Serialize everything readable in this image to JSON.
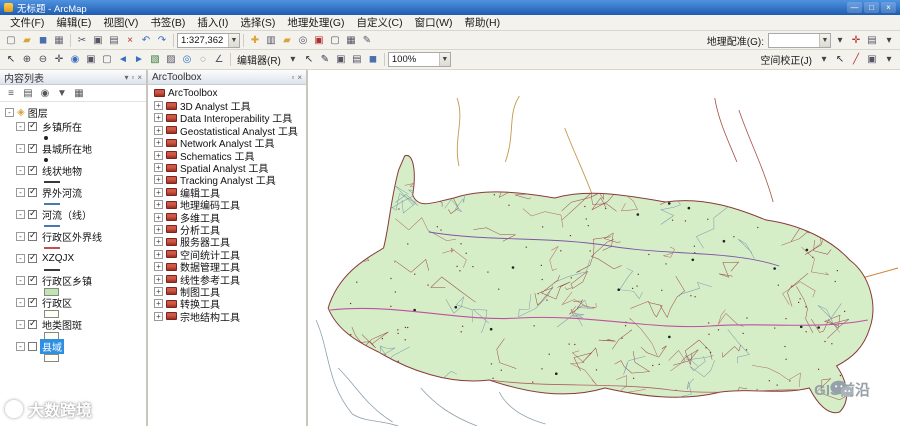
{
  "window": {
    "title": "无标题 - ArcMap"
  },
  "titlebar_controls": {
    "minimize": "—",
    "maximize": "□",
    "close": "×"
  },
  "menus": [
    "文件(F)",
    "编辑(E)",
    "视图(V)",
    "书签(B)",
    "插入(I)",
    "选择(S)",
    "地理处理(G)",
    "自定义(C)",
    "窗口(W)",
    "帮助(H)"
  ],
  "toolbars": {
    "scale_value": "1:327,362",
    "zoom_value": "100%",
    "georeferencing_label": "地理配准(G):",
    "editor_label": "编辑器(R)",
    "spatial_adjustment_label": "空间校正(J)",
    "row1_file_icons": [
      [
        "new-document",
        "▢",
        "#667"
      ],
      [
        "open-folder",
        "▰",
        "#d9a33a"
      ],
      [
        "save",
        "◼",
        "#4a6fae"
      ],
      [
        "print",
        "▦",
        "#667"
      ]
    ],
    "row1_edit_icons": [
      [
        "cut",
        "✂",
        "#556"
      ],
      [
        "copy",
        "▣",
        "#556"
      ],
      [
        "paste",
        "▤",
        "#556"
      ],
      [
        "delete",
        "×",
        "#b03030"
      ],
      [
        "undo",
        "↶",
        "#3a6fc0"
      ],
      [
        "redo",
        "↷",
        "#3a6fc0"
      ]
    ],
    "row1_map_icons": [
      [
        "add-data",
        "✚",
        "#d9a33a"
      ],
      [
        "table-of-contents",
        "▥",
        "#556"
      ],
      [
        "catalog-window",
        "▰",
        "#d9a33a"
      ],
      [
        "search-window",
        "◎",
        "#556"
      ],
      [
        "arctoolbox-window",
        "▣",
        "#b03030"
      ],
      [
        "python-window",
        "▢",
        "#556"
      ],
      [
        "model-builder",
        "▦",
        "#556"
      ],
      [
        "editor-toolbar-toggle",
        "✎",
        "#556"
      ]
    ],
    "row1_georef_icons": [
      [
        "georef-dropdown",
        "▾",
        "#444"
      ],
      [
        "add-control-points",
        "✛",
        "#b03030"
      ],
      [
        "view-link-table",
        "▤",
        "#556"
      ]
    ],
    "row2_nav_icons": [
      [
        "select-elements",
        "↖",
        "#334"
      ],
      [
        "zoom-in-tool",
        "⊕",
        "#445"
      ],
      [
        "zoom-out-tool",
        "⊖",
        "#445"
      ],
      [
        "pan-tool",
        "✛",
        "#445"
      ],
      [
        "full-extent",
        "◉",
        "#3a6fc0"
      ],
      [
        "fixed-zoom-in",
        "▣",
        "#556"
      ],
      [
        "fixed-zoom-out",
        "▢",
        "#556"
      ],
      [
        "previous-extent",
        "◄",
        "#3a6fc0"
      ],
      [
        "next-extent",
        "►",
        "#3a6fc0"
      ],
      [
        "select-by-rectangle",
        "▧",
        "#3a7a3a"
      ],
      [
        "clear-selection",
        "▨",
        "#556"
      ],
      [
        "identify",
        "◎",
        "#2a6fc0"
      ],
      [
        "find",
        "◌",
        "#556"
      ],
      [
        "measure",
        "∠",
        "#556"
      ]
    ],
    "row2_editor_icons": [
      [
        "editor-dropdown",
        "▾",
        "#444"
      ],
      [
        "edit-pointer",
        "↖",
        "#334"
      ],
      [
        "sketch-tool",
        "✎",
        "#334"
      ],
      [
        "create-features",
        "▣",
        "#556"
      ],
      [
        "attributes",
        "▤",
        "#556"
      ],
      [
        "save-edits",
        "◼",
        "#4a6fae"
      ]
    ],
    "row2_spatial_icons": [
      [
        "spatial-dropdown",
        "▾",
        "#444"
      ],
      [
        "adjust-pointer",
        "↖",
        "#334"
      ],
      [
        "new-displacement-link",
        "╱",
        "#b03030"
      ],
      [
        "run-adjust",
        "▣",
        "#556"
      ]
    ],
    "row_end_icons": [
      [
        "toolbar-options",
        "▾",
        "#444"
      ]
    ]
  },
  "toc": {
    "title": "内容列表",
    "tools": [
      [
        "list-by-drawing-order",
        "≡"
      ],
      [
        "list-by-source",
        "▤"
      ],
      [
        "list-by-visibility",
        "◉"
      ],
      [
        "list-by-selection",
        "▼"
      ],
      [
        "toc-options",
        "▦"
      ]
    ],
    "root_label": "图层",
    "layers": [
      {
        "label": "乡镇所在",
        "checked": true,
        "symbol": "point",
        "selected": false
      },
      {
        "label": "县城所在地",
        "checked": true,
        "symbol": "point",
        "selected": false
      },
      {
        "label": "线状地物",
        "checked": true,
        "symbol": "line-dark",
        "selected": false
      },
      {
        "label": "界外河流",
        "checked": true,
        "symbol": "line-blue",
        "selected": false
      },
      {
        "label": "河流（线）",
        "checked": true,
        "symbol": "line-blue",
        "selected": false
      },
      {
        "label": "行政区外界线",
        "checked": true,
        "symbol": "line-red",
        "selected": false
      },
      {
        "label": "XZQJX",
        "checked": true,
        "symbol": "line-dark",
        "selected": false
      },
      {
        "label": "行政区乡镇",
        "checked": true,
        "symbol": "fill-green",
        "selected": false
      },
      {
        "label": "行政区",
        "checked": true,
        "symbol": "fill-hollow",
        "selected": false
      },
      {
        "label": "地类图斑",
        "checked": true,
        "symbol": "fill-hollow",
        "selected": false
      },
      {
        "label": "县域",
        "checked": false,
        "symbol": "fill-hollow",
        "selected": true
      }
    ]
  },
  "toolbox": {
    "title": "ArcToolbox",
    "root_label": "ArcToolbox",
    "items": [
      "3D Analyst 工具",
      "Data Interoperability 工具",
      "Geostatistical Analyst 工具",
      "Network Analyst 工具",
      "Schematics 工具",
      "Spatial Analyst 工具",
      "Tracking Analyst 工具",
      "编辑工具",
      "地理编码工具",
      "多维工具",
      "分析工具",
      "服务器工具",
      "空间统计工具",
      "数据管理工具",
      "线性参考工具",
      "制图工具",
      "转换工具",
      "宗地结构工具"
    ]
  },
  "watermarks": {
    "bottom_left": "大数跨境",
    "bottom_right": "GIS前沿"
  },
  "map_colors": {
    "fill": "#d5eec8",
    "boundary": "#8a3a3a"
  }
}
